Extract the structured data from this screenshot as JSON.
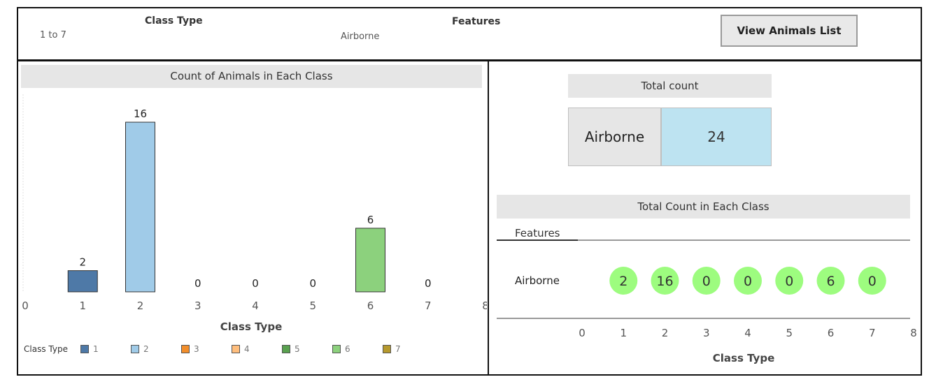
{
  "filters": {
    "class_type": {
      "title": "Class Type",
      "value": "1 to 7"
    },
    "features": {
      "title": "Features",
      "value": "Airborne"
    },
    "view_button": "View Animals List"
  },
  "left_chart": {
    "title": "Count of Animals in Each Class",
    "xlabel": "Class Type",
    "x_ticks": [
      "0",
      "1",
      "2",
      "3",
      "4",
      "5",
      "6",
      "7",
      "8"
    ]
  },
  "kpi": {
    "header": "Total count",
    "label": "Airborne",
    "value": "24"
  },
  "right_chart": {
    "title": "Total Count in Each Class",
    "row_header": "Features",
    "row_label": "Airborne",
    "xlabel": "Class Type",
    "x_ticks": [
      "0",
      "1",
      "2",
      "3",
      "4",
      "5",
      "6",
      "7",
      "8"
    ]
  },
  "legend": {
    "title": "Class Type",
    "items": [
      {
        "label": "1",
        "color": "#4e79a7"
      },
      {
        "label": "2",
        "color": "#a0cbe8"
      },
      {
        "label": "3",
        "color": "#f28e2b"
      },
      {
        "label": "4",
        "color": "#ffbe7d"
      },
      {
        "label": "5",
        "color": "#59a14f"
      },
      {
        "label": "6",
        "color": "#8cd17d"
      },
      {
        "label": "7",
        "color": "#b6992d"
      }
    ]
  },
  "chart_data": [
    {
      "type": "bar",
      "title": "Count of Animals in Each Class",
      "xlabel": "Class Type",
      "ylabel": "",
      "categories": [
        "1",
        "2",
        "3",
        "4",
        "5",
        "6",
        "7"
      ],
      "values": [
        2,
        16,
        0,
        0,
        0,
        6,
        0
      ],
      "xlim": [
        0,
        8
      ],
      "ylim": [
        0,
        16
      ],
      "colors": [
        "#4e79a7",
        "#a0cbe8",
        "#f28e2b",
        "#ffbe7d",
        "#59a14f",
        "#8cd17d",
        "#b6992d"
      ],
      "legend": "bottom"
    },
    {
      "type": "scatter",
      "title": "Total Count in Each Class",
      "xlabel": "Class Type",
      "ylabel": "Features",
      "row": "Airborne",
      "x": [
        1,
        2,
        3,
        4,
        5,
        6,
        7
      ],
      "values": [
        2,
        16,
        0,
        0,
        0,
        6,
        0
      ],
      "xlim": [
        0,
        8
      ],
      "marker_color": "#9dfc7f"
    }
  ]
}
